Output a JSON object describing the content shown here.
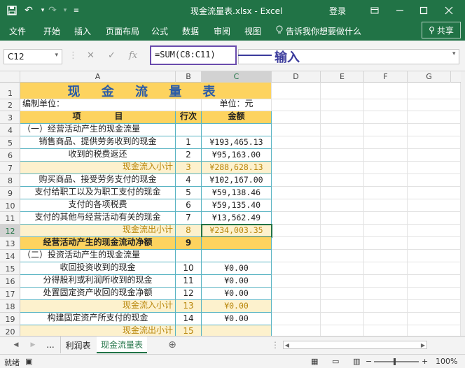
{
  "titlebar": {
    "doc_title": "现金流量表.xlsx  -  Excel",
    "login": "登录",
    "save_icon": "save-icon",
    "undo_icon": "undo-icon",
    "redo_icon": "redo-icon"
  },
  "ribbon": {
    "tabs": [
      "文件",
      "开始",
      "插入",
      "页面布局",
      "公式",
      "数据",
      "审阅",
      "视图"
    ],
    "tell_me": "告诉我你想要做什么",
    "share": "共享"
  },
  "formula_bar": {
    "name_box": "C12",
    "formula": "=SUM(C8:C11)",
    "annotation": "输入"
  },
  "columns": [
    "A",
    "B",
    "C",
    "D",
    "E",
    "F",
    "G"
  ],
  "rows": [
    {
      "n": "1",
      "a": "现 金 流 量 表",
      "b": "",
      "c": ""
    },
    {
      "n": "2",
      "a": "编制单位：",
      "b": "",
      "c": "单位：元"
    },
    {
      "n": "3",
      "a": "项　　　　目",
      "b": "行次",
      "c": "金额"
    },
    {
      "n": "4",
      "a": "（一）经营活动产生的现金流量",
      "b": "",
      "c": ""
    },
    {
      "n": "5",
      "a": "销售商品、提供劳务收到的现金",
      "b": "1",
      "c": "¥193,465.13"
    },
    {
      "n": "6",
      "a": "收到的税费返还",
      "b": "2",
      "c": "¥95,163.00"
    },
    {
      "n": "7",
      "a": "现金流入小计",
      "b": "3",
      "c": "¥288,628.13"
    },
    {
      "n": "8",
      "a": "购买商品、接受劳务支付的现金",
      "b": "4",
      "c": "¥102,167.00"
    },
    {
      "n": "9",
      "a": "支付给职工以及为职工支付的现金",
      "b": "5",
      "c": "¥59,138.46"
    },
    {
      "n": "10",
      "a": "支付的各项税费",
      "b": "6",
      "c": "¥59,135.40"
    },
    {
      "n": "11",
      "a": "支付的其他与经营活动有关的现金",
      "b": "7",
      "c": "¥13,562.49"
    },
    {
      "n": "12",
      "a": "现金流出小计",
      "b": "8",
      "c": "¥234,003.35"
    },
    {
      "n": "13",
      "a": "经营活动产生的现金流动净额",
      "b": "9",
      "c": ""
    },
    {
      "n": "14",
      "a": "（二）投资活动产生的现金流量",
      "b": "",
      "c": ""
    },
    {
      "n": "15",
      "a": "收回投资收到的现金",
      "b": "10",
      "c": "¥0.00"
    },
    {
      "n": "16",
      "a": "分得股利或利润所收到的现金",
      "b": "11",
      "c": "¥0.00"
    },
    {
      "n": "17",
      "a": "处置固定资产收回的现金净额",
      "b": "12",
      "c": "¥0.00"
    },
    {
      "n": "18",
      "a": "现金流入小计",
      "b": "13",
      "c": "¥0.00"
    },
    {
      "n": "19",
      "a": "构建固定资产所支付的现金",
      "b": "14",
      "c": "¥0.00"
    },
    {
      "n": "20",
      "a": "现金流出小计",
      "b": "15",
      "c": ""
    }
  ],
  "sheets": {
    "more": "...",
    "tab1": "利润表",
    "tab2": "现金流量表"
  },
  "status": {
    "ready": "就绪",
    "zoom": "100%"
  },
  "colors": {
    "excel_green": "#217346",
    "header_yellow": "#fdd35f",
    "subtotal_yellow": "#fdf1cd",
    "annotation": "#3b3b9c"
  }
}
